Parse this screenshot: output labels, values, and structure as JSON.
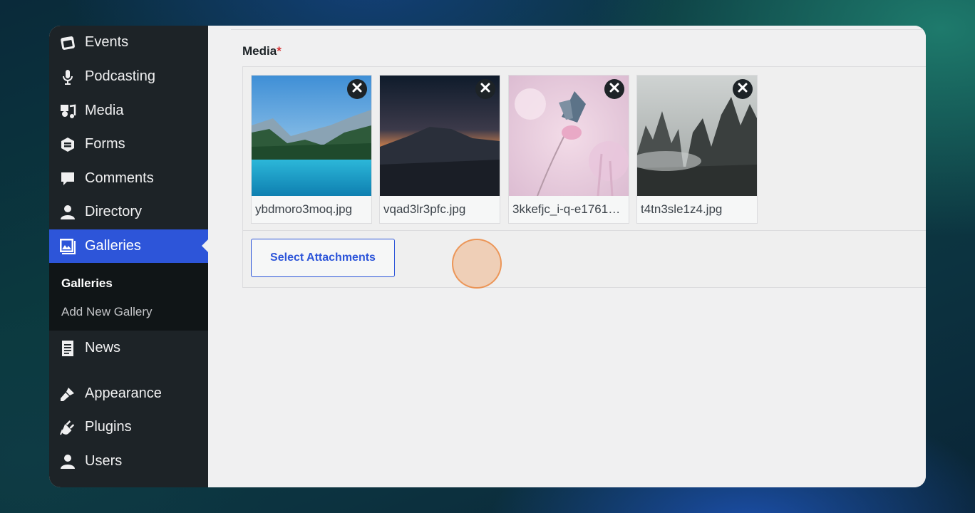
{
  "sidebar": {
    "items": [
      {
        "label": "Events",
        "icon": "calendar-icon"
      },
      {
        "label": "Podcasting",
        "icon": "microphone-icon"
      },
      {
        "label": "Media",
        "icon": "media-icon"
      },
      {
        "label": "Forms",
        "icon": "forms-icon"
      },
      {
        "label": "Comments",
        "icon": "comment-icon"
      },
      {
        "label": "Directory",
        "icon": "person-icon"
      },
      {
        "label": "Galleries",
        "icon": "gallery-icon"
      },
      {
        "label": "News",
        "icon": "document-icon"
      },
      {
        "label": "Appearance",
        "icon": "brush-icon"
      },
      {
        "label": "Plugins",
        "icon": "plug-icon"
      },
      {
        "label": "Users",
        "icon": "users-icon"
      }
    ],
    "active_item": "Galleries",
    "submenu": [
      {
        "label": "Galleries",
        "current": true
      },
      {
        "label": "Add New Gallery",
        "current": false
      }
    ]
  },
  "media_field": {
    "label": "Media",
    "required_mark": "*",
    "attachments": [
      {
        "filename": "ybdmoro3moq.jpg",
        "subject": "mountain-lake"
      },
      {
        "filename": "vqad3lr3pfc.jpg",
        "subject": "sunset-mountains"
      },
      {
        "filename": "3kkefjc_i-q-e1761…",
        "subject": "butterfly-flower"
      },
      {
        "filename": "t4tn3sle1z4.jpg",
        "subject": "misty-peaks"
      }
    ],
    "select_button_label": "Select Attachments"
  },
  "colors": {
    "sidebar_bg": "#1d2327",
    "accent": "#2d55d9",
    "content_bg": "#f0f0f1",
    "required": "#d63638"
  }
}
